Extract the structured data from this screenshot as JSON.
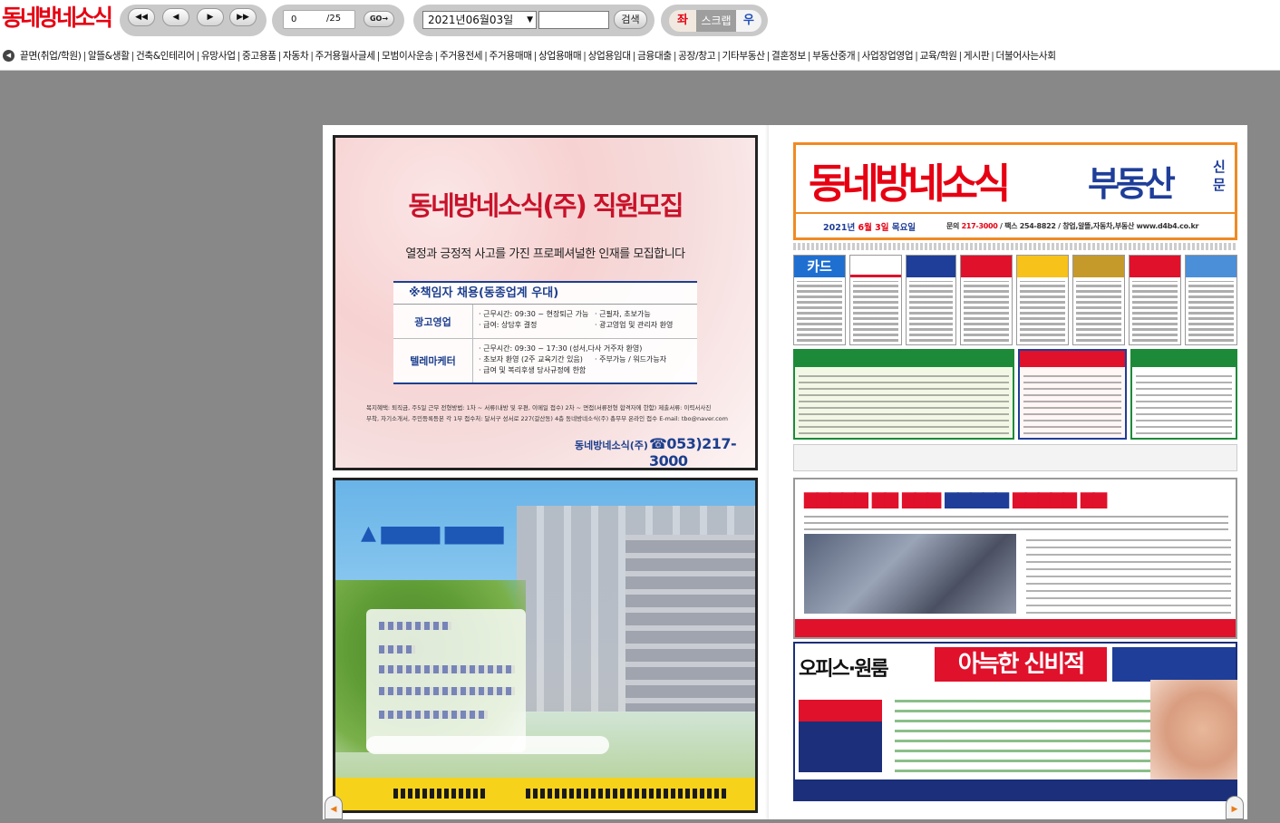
{
  "header": {
    "logo_text": "동네방네소식",
    "nav": {
      "first_label": "◀◀",
      "prev_label": "◀",
      "next_label": "▶",
      "last_label": "▶▶"
    },
    "page": {
      "current": "0",
      "total": "/25",
      "go_label": "GO→"
    },
    "date": {
      "selected": "2021년06월03일",
      "search_value": "",
      "search_label": "검색"
    },
    "view": {
      "left_label": "좌",
      "scroll_label": "스크랩",
      "right_label": "우"
    }
  },
  "categories": [
    "끝면(취업/학원)",
    "알뜰&생활",
    "건축&인테리어",
    "유망사업",
    "중고용품",
    "자동차",
    "주거용월사글세",
    "모범이사운송",
    "주거용전세",
    "주거용매매",
    "상업용매매",
    "상업용임대",
    "금융대출",
    "공장/창고",
    "기타부동산",
    "결혼정보",
    "부동산중개",
    "사업장업영업",
    "교육/학원",
    "게시판",
    "더불어사는사회"
  ],
  "left_page": {
    "recruit_ad": {
      "title": "동네방네소식(주) 직원모집",
      "subtitle": "열정과 긍정적 사고를 가진 프로페셔널한 인재를 모집합니다",
      "table_header": "※책임자 채용(동종업계 우대)",
      "rows": [
        {
          "role": "광고영업",
          "col1_line1": "· 근무시간: 09:30 ~ 현장퇴근 가능",
          "col1_line2": "· 급여: 상담후 결정",
          "col2_line1": "· 근필자, 초보가능",
          "col2_line2": "· 광고영업 및 관리자 환영"
        },
        {
          "role": "텔레마케터",
          "col1_line1": "· 근무시간: 09:30 ~ 17:30 (성서,다사 거주자 환영)",
          "col1_line2": "· 초보자 환영 (2주 교육기간 있음)",
          "col1_line3": "· 급여 및 복리후생 당사규정에 한함",
          "col2_line2": "· 주부가능 / 워드가능자"
        }
      ],
      "fine_print_1": "복지혜택: 퇴직금, 주5일 근무 전형방법: 1차 ~ 서류(내방 및 우편, 이메일 접수) 2차 ~ 면접(서류전형 합격자에 한함) 제출서류: 이력서사진",
      "fine_print_2": "부착, 자기소개서, 주민등록등본 각 1부 접수처: 달서구 성서로 227(갈산동) 4층 동네방네소식(주) 총무부 온라인 접수 E-mail: tbo@naver.com",
      "company": "동네방네소식(주)",
      "phone": "☎053)217-3000"
    }
  },
  "right_page": {
    "masthead": {
      "title": "동네방네소식",
      "section": "부동산",
      "paper_1": "신",
      "paper_2": "문",
      "date_prefix": "2021년",
      "date_highlight": "6월 3일",
      "date_suffix": "목요일",
      "contact_prefix": "문의",
      "contact_phone": "217-3000",
      "contact_rest": "/ 팩스 254-8822 / 창업,알뜰,자동차,부동산   www.d4b4.co.kr"
    },
    "first_thumb_label": "카드",
    "bottom_ad_head_1": "오피스·원룸",
    "bottom_ad_head_2": "아늑한 신비적"
  }
}
